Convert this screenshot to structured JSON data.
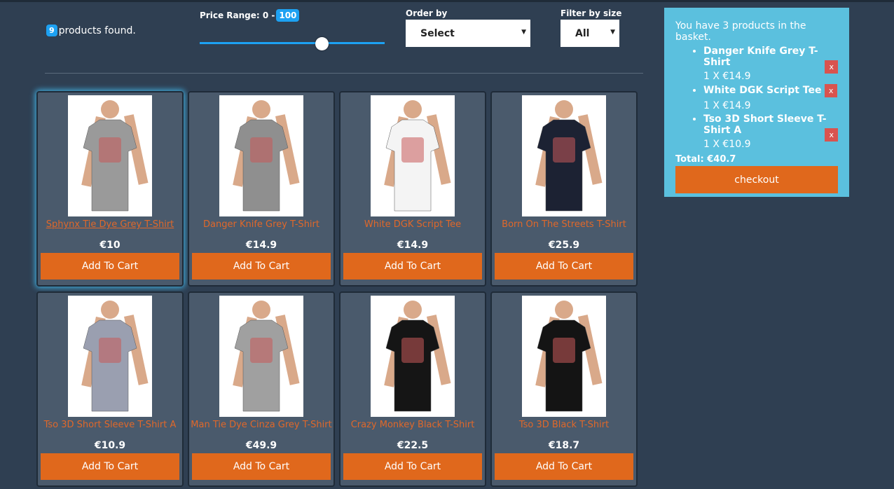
{
  "header": {
    "found_count": "9",
    "found_text": "products found.",
    "price_label": "Price Range: 0 -",
    "price_max": "100",
    "price_value_fraction": 0.66,
    "order_label": "Order by",
    "order_value": "Select",
    "size_label": "Filter by size",
    "size_value": "All"
  },
  "products": [
    {
      "title": "Sphynx Tie Dye Grey T-Shirt",
      "price": "€10",
      "button": "Add To Cart",
      "shirt_color": "#9a9a9a",
      "highlight": true
    },
    {
      "title": "Danger Knife Grey T-Shirt",
      "price": "€14.9",
      "button": "Add To Cart",
      "shirt_color": "#8f8f8f"
    },
    {
      "title": "White DGK Script Tee",
      "price": "€14.9",
      "button": "Add To Cart",
      "shirt_color": "#f4f4f4"
    },
    {
      "title": "Born On The Streets T-Shirt",
      "price": "€25.9",
      "button": "Add To Cart",
      "shirt_color": "#1c2233"
    },
    {
      "title": "Tso 3D Short Sleeve T-Shirt A",
      "price": "€10.9",
      "button": "Add To Cart",
      "shirt_color": "#9a9fb0"
    },
    {
      "title": "Man Tie Dye Cinza Grey T-Shirt",
      "price": "€49.9",
      "button": "Add To Cart",
      "shirt_color": "#a0a0a0"
    },
    {
      "title": "Crazy Monkey Black T-Shirt",
      "price": "€22.5",
      "button": "Add To Cart",
      "shirt_color": "#151515"
    },
    {
      "title": "Tso 3D Black T-Shirt",
      "price": "€18.7",
      "button": "Add To Cart",
      "shirt_color": "#141414"
    }
  ],
  "basket": {
    "heading": "You have 3 products in the basket.",
    "items": [
      {
        "name": "Danger Knife Grey T-Shirt",
        "qty": "1 X €14.9",
        "remove": "x"
      },
      {
        "name": "White DGK Script Tee",
        "qty": "1 X €14.9",
        "remove": "x"
      },
      {
        "name": "Tso 3D Short Sleeve T-Shirt A",
        "qty": "1 X €10.9",
        "remove": "x"
      }
    ],
    "total": "Total: €40.7",
    "checkout": "checkout"
  },
  "colors": {
    "background": "#2f3f52",
    "accent_orange": "#e0681c",
    "accent_blue": "#1da1f2",
    "basket_bg": "#5bc0de",
    "remove_red": "#d9534f"
  }
}
